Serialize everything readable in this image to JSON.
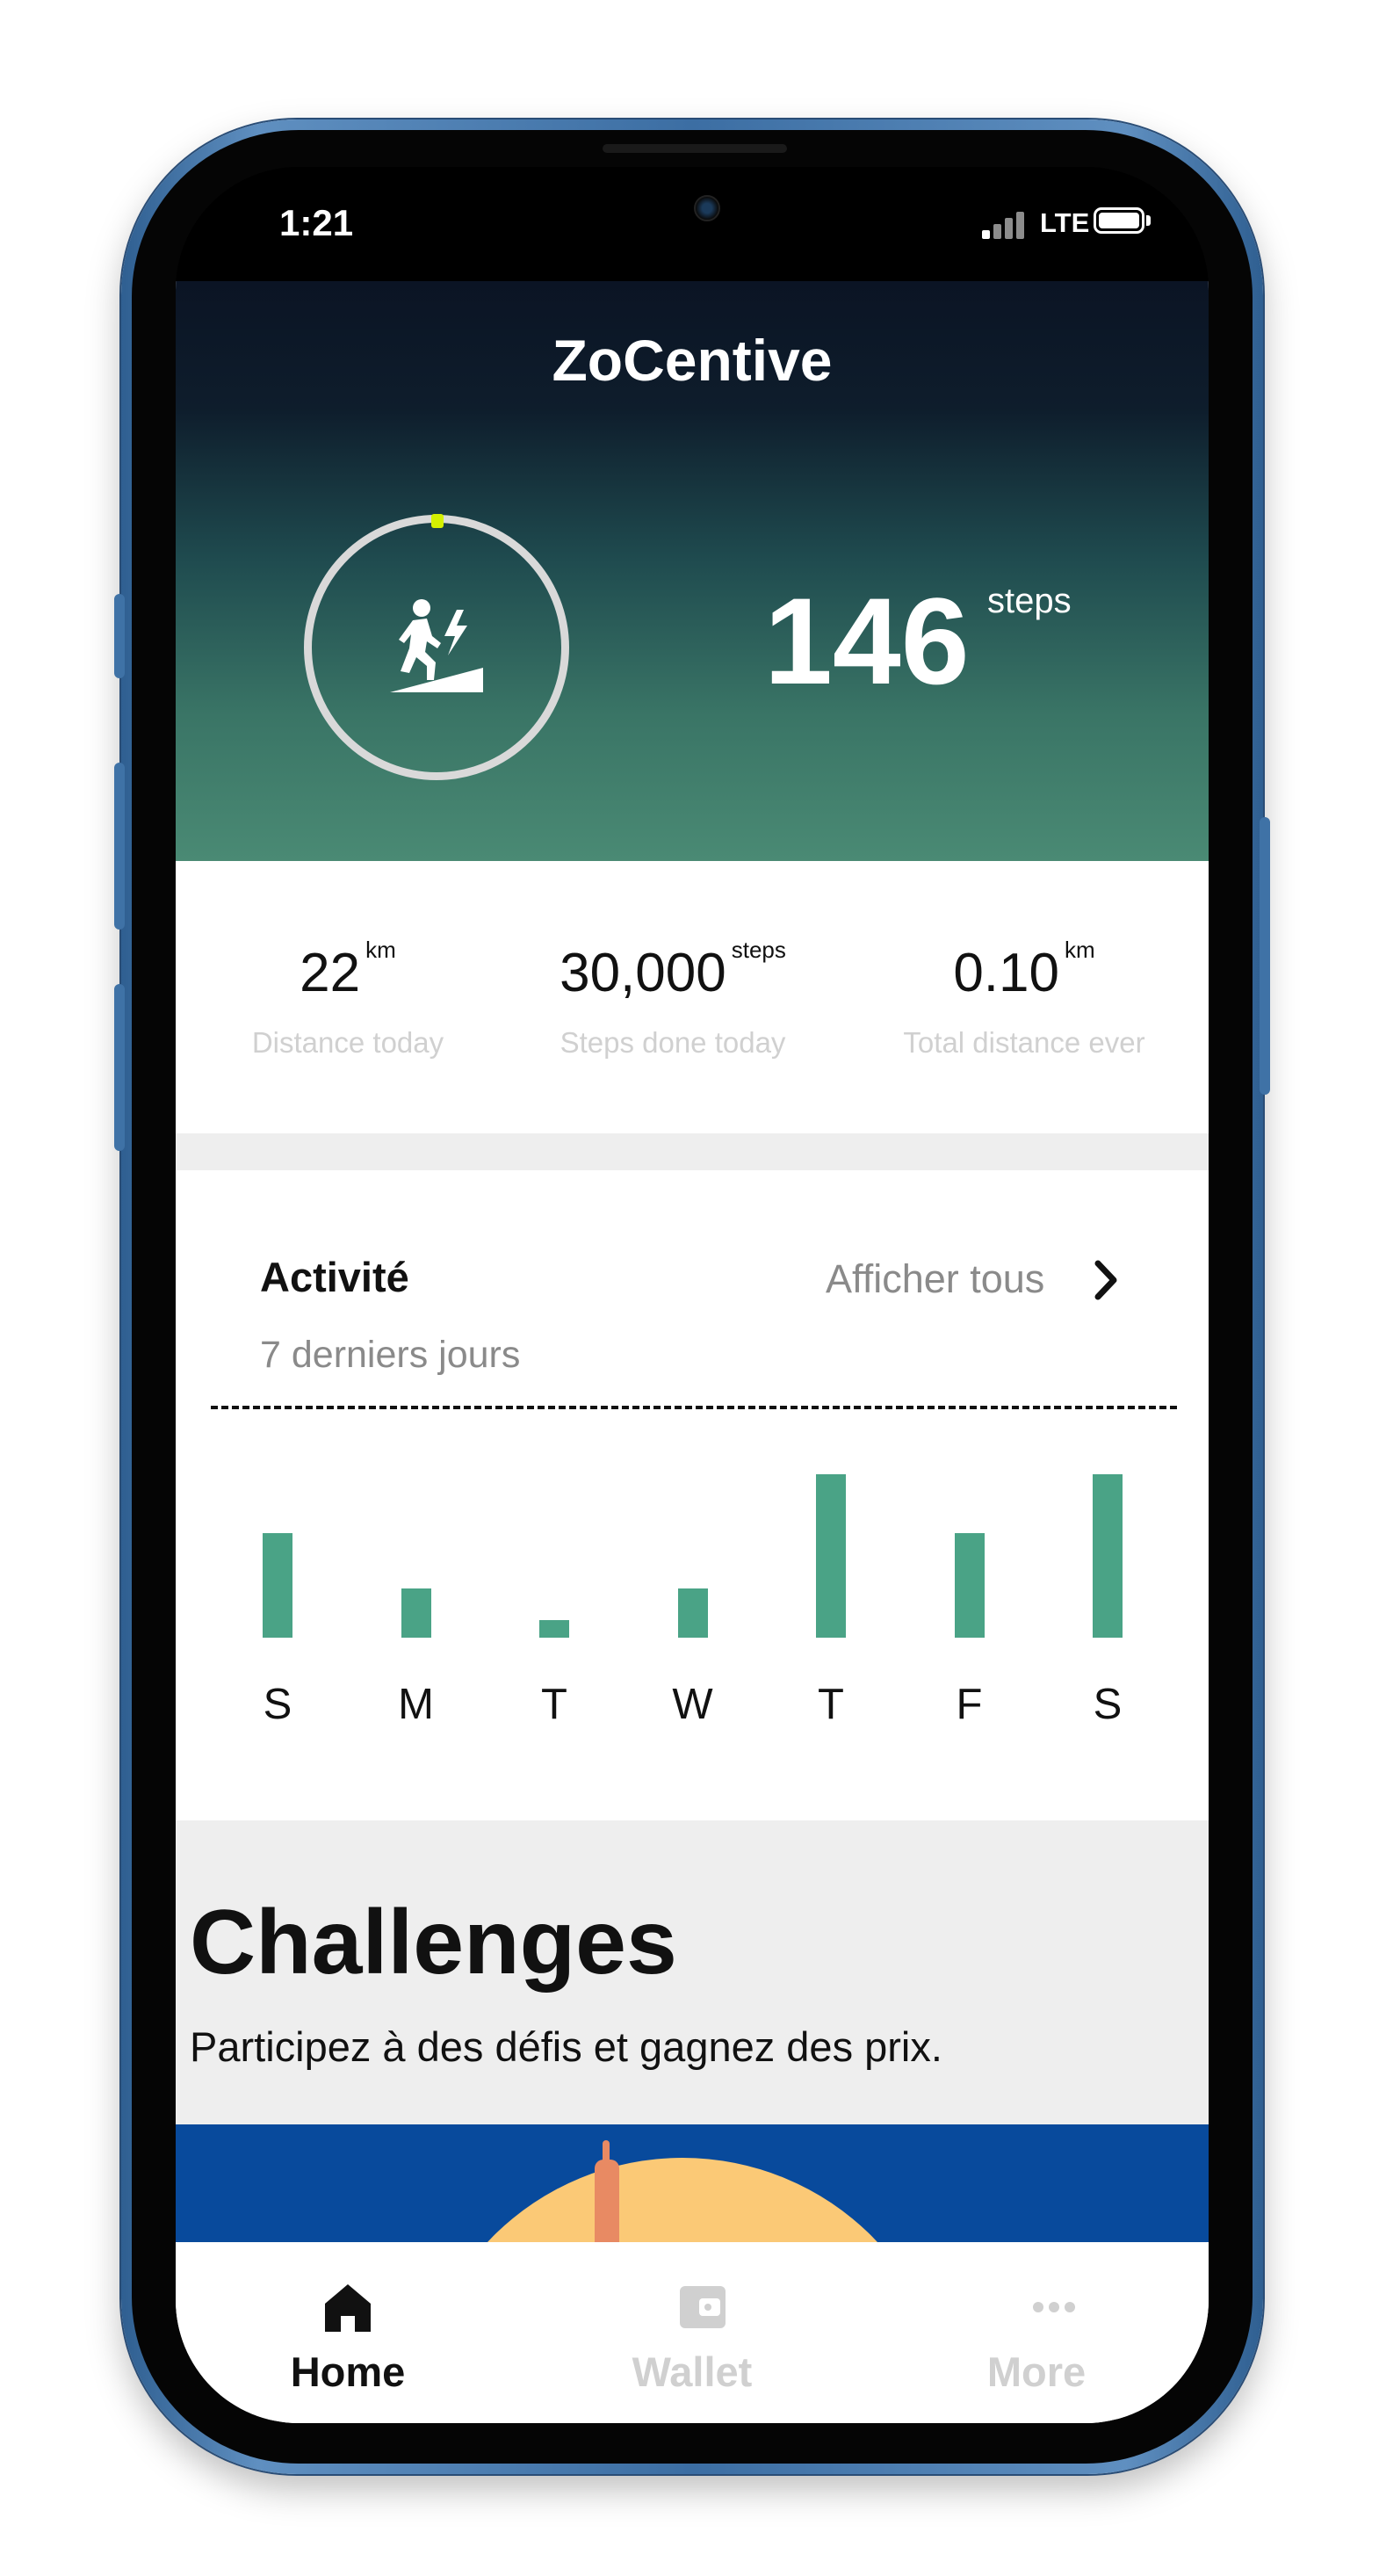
{
  "status_bar": {
    "time": "1:21",
    "network": "LTE"
  },
  "app": {
    "title": "ZoCentive"
  },
  "hero": {
    "steps_value": "146",
    "steps_unit": "steps",
    "ring_icon": "walking-uphill-icon"
  },
  "stats": [
    {
      "value": "22",
      "unit": "km",
      "label": "Distance today"
    },
    {
      "value": "30,000",
      "unit": "steps",
      "label": "Steps done today"
    },
    {
      "value": "0.10",
      "unit": "km",
      "label": "Total distance ever"
    }
  ],
  "activity": {
    "title": "Activité",
    "subtitle": "7 derniers jours",
    "link_label": "Afficher tous",
    "days": [
      "S",
      "M",
      "T",
      "W",
      "T",
      "F",
      "S"
    ],
    "bar_levels": [
      0.64,
      0.3,
      0.11,
      0.3,
      1.0,
      0.64,
      1.0
    ],
    "bar_color": "#4aa386"
  },
  "challenges": {
    "title": "Challenges",
    "subtitle": "Participez à des défis et gagnez des prix."
  },
  "tabbar": {
    "tabs": [
      {
        "label": "Home",
        "icon": "home-icon",
        "active": true
      },
      {
        "label": "Wallet",
        "icon": "wallet-icon",
        "active": false
      },
      {
        "label": "More",
        "icon": "more-icon",
        "active": false
      }
    ]
  },
  "colors": {
    "accent": "#4aa386",
    "ring_marker": "#d4f000",
    "banner": "#084a9c",
    "sun": "#fbc976"
  }
}
